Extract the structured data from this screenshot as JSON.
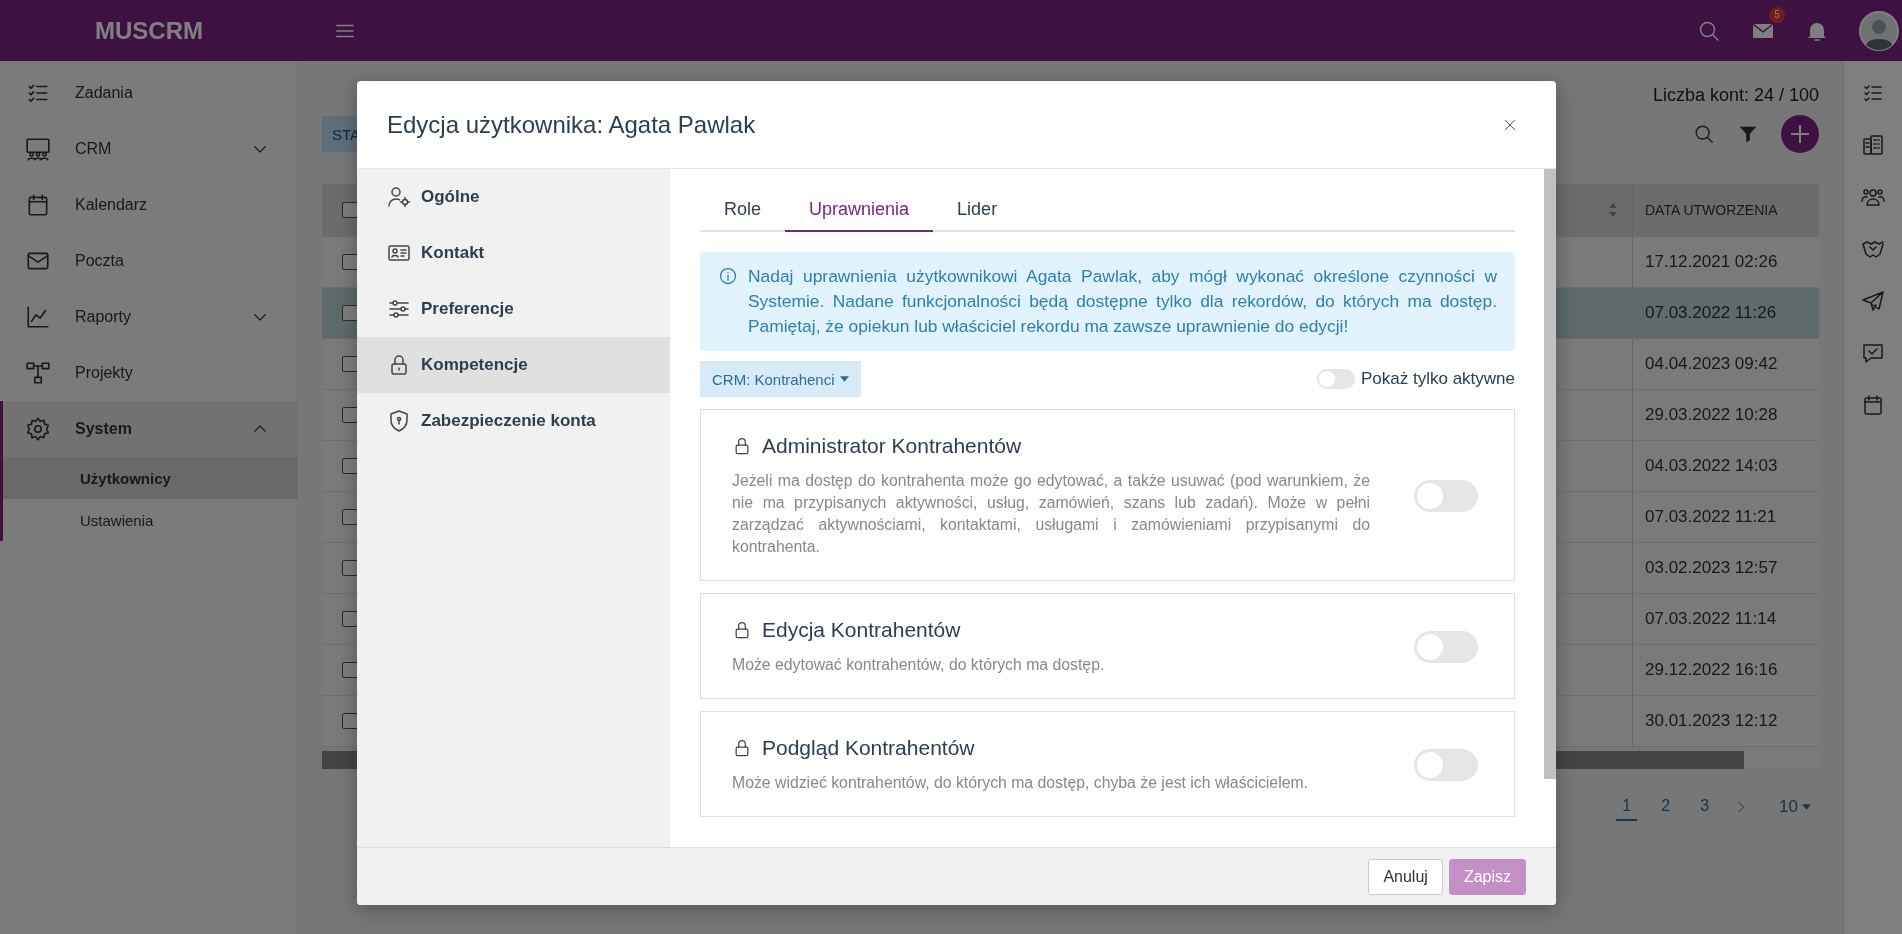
{
  "app": {
    "logo": "MUSCRM",
    "mail_badge": "5"
  },
  "sidebar": {
    "items": [
      {
        "label": "Zadania",
        "selected": false
      },
      {
        "label": "CRM",
        "selected": false,
        "expanded": false
      },
      {
        "label": "Kalendarz",
        "selected": false
      },
      {
        "label": "Poczta",
        "selected": false
      },
      {
        "label": "Raporty",
        "selected": false,
        "expanded": false
      },
      {
        "label": "Projekty",
        "selected": false
      },
      {
        "label": "System",
        "selected": true,
        "expanded": true,
        "children": [
          {
            "label": "Użytkownicy",
            "selected": true
          },
          {
            "label": "Ustawienia",
            "selected": false
          }
        ]
      }
    ]
  },
  "background": {
    "account_count": "Liczba kont: 24 / 100",
    "status_button": "STA",
    "table": {
      "columns": [
        "DATA UTWORZENIA"
      ],
      "header_checked": false,
      "rows": [
        {
          "date": "17.12.2021 02:26",
          "selected": false,
          "checked": false
        },
        {
          "date": "07.03.2022 11:26",
          "selected": true,
          "checked": false
        },
        {
          "date": "04.04.2023 09:42",
          "selected": false,
          "checked": false
        },
        {
          "date": "29.03.2022 10:28",
          "selected": false,
          "checked": false
        },
        {
          "date": "04.03.2022 14:03",
          "selected": false,
          "checked": false
        },
        {
          "date": "07.03.2022 11:21",
          "selected": false,
          "checked": false
        },
        {
          "date": "03.02.2023 12:57",
          "selected": false,
          "checked": false
        },
        {
          "date": "07.03.2022 11:14",
          "selected": false,
          "checked": false
        },
        {
          "date": "29.12.2022 16:16",
          "selected": false,
          "checked": false
        },
        {
          "date": "30.01.2023 12:12",
          "selected": false,
          "checked": false
        }
      ]
    },
    "pagination": {
      "pages": [
        {
          "label": "1",
          "selected": true
        },
        {
          "label": "2",
          "selected": false
        },
        {
          "label": "3",
          "selected": false
        }
      ],
      "page_size": "10"
    }
  },
  "modal": {
    "title": "Edycja użytkownika: Agata Pawlak",
    "nav": [
      {
        "label": "Ogólne",
        "selected": false
      },
      {
        "label": "Kontakt",
        "selected": false
      },
      {
        "label": "Preferencje",
        "selected": false
      },
      {
        "label": "Kompetencje",
        "selected": true
      },
      {
        "label": "Zabezpieczenie konta",
        "selected": false
      }
    ],
    "tabs": [
      {
        "label": "Role",
        "selected": false
      },
      {
        "label": "Uprawnienia",
        "selected": true
      },
      {
        "label": "Lider",
        "selected": false
      }
    ],
    "info": "Nadaj uprawnienia użytkownikowi Agata Pawlak, aby mógł wykonać określone czynności w Systemie. Nadane funkcjonalności będą dostępne tylko dla rekordów, do których ma dostęp. Pamiętaj, że opiekun lub właściciel rekordu ma zawsze uprawnienie do edycji!",
    "filter": {
      "label": "CRM: Kontrahenci"
    },
    "show_active": {
      "label": "Pokaż tylko aktywne",
      "on": false
    },
    "permissions": [
      {
        "title": "Administrator Kontrahentów",
        "description": "Jeżeli ma dostęp do kontrahenta może go edytować, a także usuwać (pod warunkiem, że nie ma przypisanych aktywności, usług, zamówień, szans lub zadań). Może w pełni zarządzać aktywnościami, kontaktami, usługami i zamówieniami przypisanymi do kontrahenta.",
        "on": false
      },
      {
        "title": "Edycja Kontrahentów",
        "description": "Może edytować kontrahentów, do których ma dostęp.",
        "on": false
      },
      {
        "title": "Podgląd Kontrahentów",
        "description": "Może widzieć kontrahentów, do których ma dostęp, chyba że jest ich właścicielem.",
        "on": false
      }
    ],
    "buttons": [
      {
        "label": "Anuluj",
        "kind": "secondary",
        "disabled": false
      },
      {
        "label": "Zapisz",
        "kind": "primary",
        "disabled": true
      }
    ]
  }
}
